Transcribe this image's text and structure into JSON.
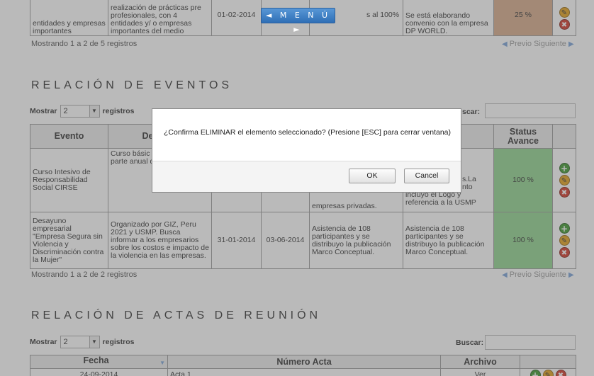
{
  "top_table": {
    "row": {
      "c1": "entidades y empresas importantes",
      "c2": "realización de prácticas pre profesionales, con 4 entidades y/ o empresas importantes del medio",
      "c3": "01-02-2014",
      "c5": "s al 100%",
      "c6": "Se está elaborando convenio con la empresa DP WORLD.",
      "status": "25 %"
    },
    "info": "Mostrando 1 a 2 de 5 registros",
    "previous": "Previo",
    "next": "Siguiente"
  },
  "menu_button": "◄ M E N Ú ►",
  "eventos": {
    "title": "RELACIÓN DE EVENTOS",
    "show_label": "Mostrar",
    "show_value": "2",
    "records_label": "registros",
    "search_label": "scar:",
    "headers": [
      "Evento",
      "Desc Ge",
      "",
      "",
      "",
      "c",
      "Status Avance",
      ""
    ],
    "rows": [
      {
        "evento": "Curso Intesivo de Responsabilidad Social CIRSE",
        "desc": "Curso básic dictado por como parte anual de ca RSE",
        "c5": "empresas privadas.",
        "c6a": "s.La",
        "c6b": "nto",
        "c6c": "incluyo el Logo y referencia a la USMP",
        "status": "100 %"
      },
      {
        "evento": "Desayuno empresarial \"Empresa Segura sin Violencia y Discriminación contra la Mujer\"",
        "desc": "Organizado por GIZ, Peru 2021 y USMP. Busca informar a los empresarios sobre los costos e impacto de la violencia en las empresas.",
        "start": "31-01-2014",
        "end": "03-06-2014",
        "c5": "Asistencia de 108 participantes y se distribuyo la publicación Marco Conceptual.",
        "c6": "Asistencia de 108 participantes y se distribuyo la publicación Marco Conceptual.",
        "status": "100 %"
      }
    ],
    "info": "Mostrando 1 a 2 de 2 registros",
    "previous": "Previo",
    "next": "Siguiente"
  },
  "actas": {
    "title": "RELACIÓN DE ACTAS DE REUNIÓN",
    "show_label": "Mostrar",
    "show_value": "2",
    "records_label": "registros",
    "search_label": "Buscar:",
    "headers": [
      "Fecha",
      "Número Acta",
      "Archivo"
    ],
    "row": {
      "fecha": "24-09-2014",
      "numero": "Acta 1",
      "archivo": "Ver"
    }
  },
  "dialog": {
    "message": "¿Confirma ELIMINAR el elemento seleccionado? (Presione [ESC] para cerrar ventana)",
    "ok": "OK",
    "cancel": "Cancel"
  },
  "colors": {
    "status_green": "#92d48f",
    "status_tan": "#d8ab8a",
    "menu_blue": "#2f6fb6"
  }
}
